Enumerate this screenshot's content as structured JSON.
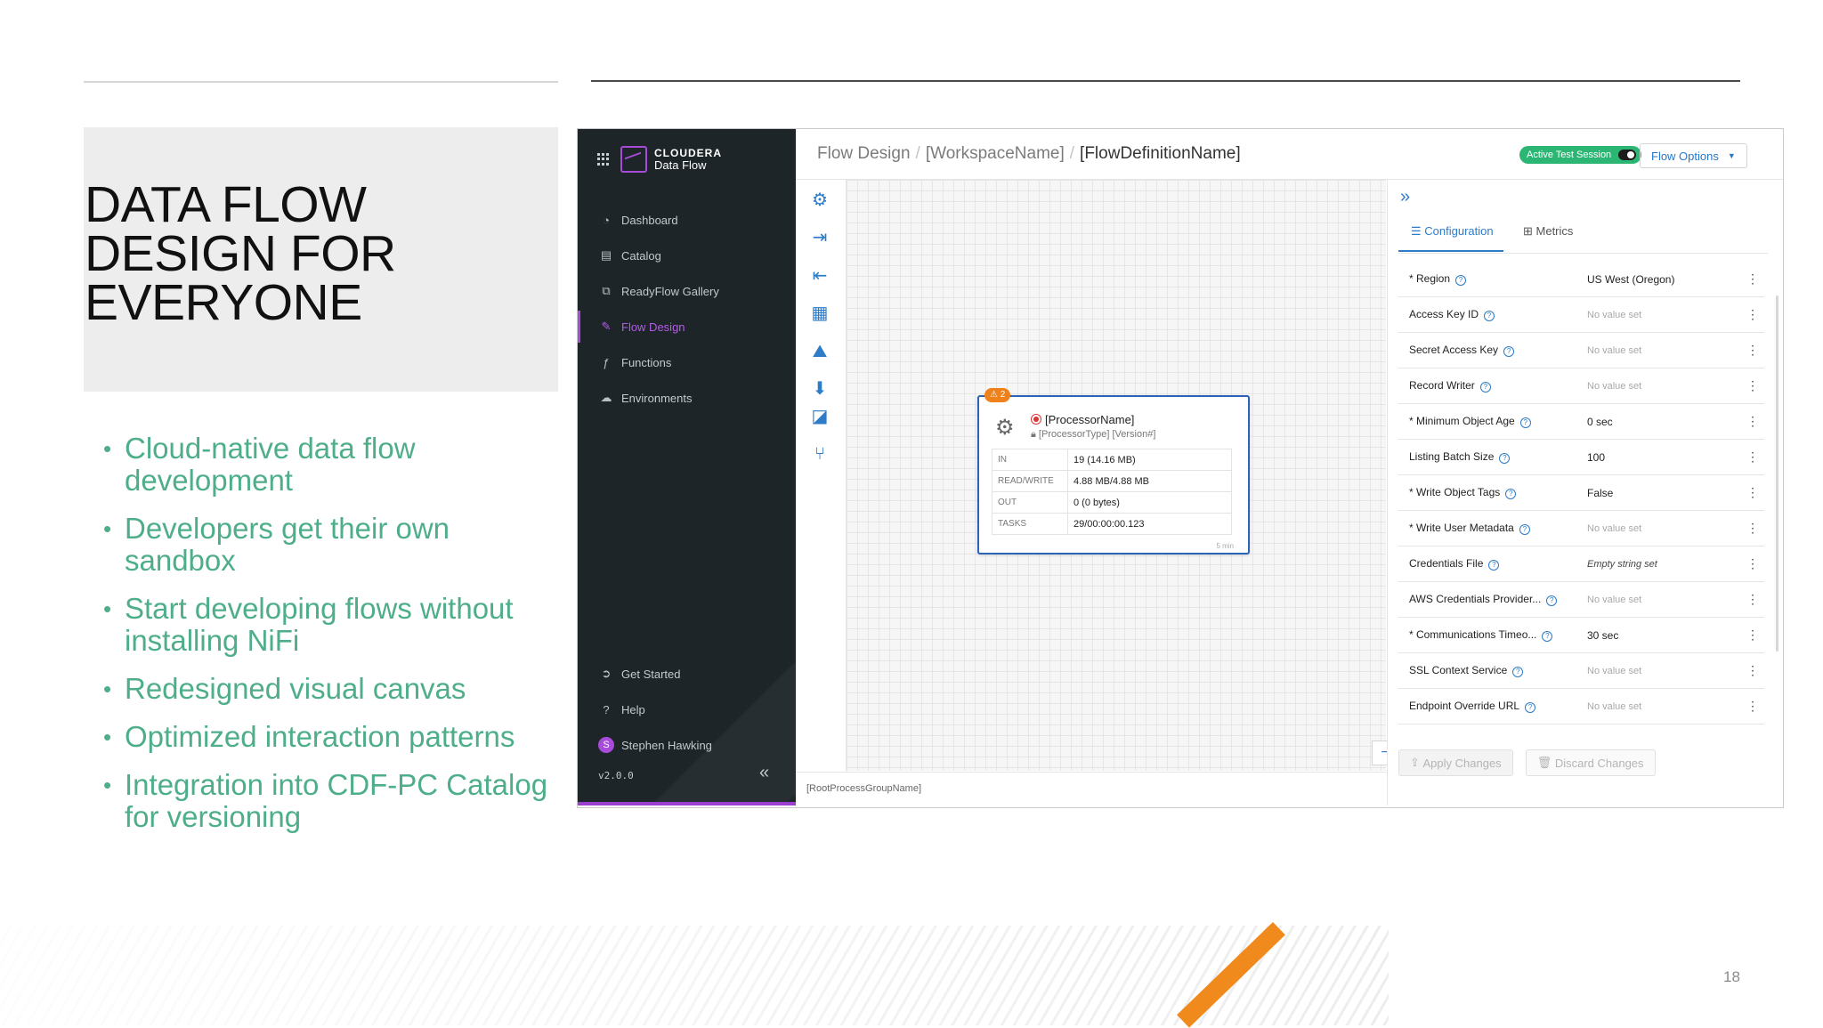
{
  "slide": {
    "title": "DATA FLOW\nDESIGN FOR\nEVERYONE",
    "bullets": [
      "Cloud-native data flow development",
      "Developers get their own sandbox",
      "Start developing flows without installing NiFi",
      "Redesigned visual canvas",
      "Optimized interaction patterns",
      "Integration into CDF-PC Catalog for versioning"
    ],
    "page_number": "18"
  },
  "app": {
    "brand_line1": "CLOUDERA",
    "brand_line2": "Data Flow",
    "nav": [
      {
        "label": "Dashboard",
        "icon": "gauge-icon"
      },
      {
        "label": "Catalog",
        "icon": "catalog-icon"
      },
      {
        "label": "ReadyFlow Gallery",
        "icon": "readyflow-icon"
      },
      {
        "label": "Flow Design",
        "icon": "edit-icon",
        "active": true
      },
      {
        "label": "Functions",
        "icon": "function-icon"
      },
      {
        "label": "Environments",
        "icon": "cloud-icon"
      }
    ],
    "footer_nav": [
      {
        "label": "Get Started",
        "icon": "arrow-circle-icon"
      },
      {
        "label": "Help",
        "icon": "help-icon"
      },
      {
        "label": "Stephen Hawking",
        "icon": "avatar",
        "initial": "S"
      }
    ],
    "version": "v2.0.0",
    "breadcrumbs": [
      "Flow Design",
      "[WorkspaceName]",
      "[FlowDefinitionName]"
    ],
    "session_label": "Active Test Session",
    "flow_options_label": "Flow Options",
    "canvas_footer": "[RootProcessGroupName]",
    "zoom": {
      "minus": "−",
      "plus": "+"
    },
    "processor": {
      "badge": "⚠ 2",
      "name": "[ProcessorName]",
      "type": "[ProcessorType] [Version#]",
      "stats": [
        {
          "key": "IN",
          "value": "19 (14.16 MB)"
        },
        {
          "key": "READ/WRITE",
          "value": "4.88 MB/4.88 MB"
        },
        {
          "key": "OUT",
          "value": "0 (0 bytes)"
        },
        {
          "key": "TASKS",
          "value": "29/00:00:00.123"
        }
      ],
      "interval": "5 min"
    },
    "panel": {
      "tabs": [
        "Configuration",
        "Metrics"
      ],
      "properties": [
        {
          "name": "* Region",
          "value": "US West (Oregon)",
          "style": "set"
        },
        {
          "name": "Access Key ID",
          "value": "No value set",
          "style": "empty"
        },
        {
          "name": "Secret Access Key",
          "value": "No value set",
          "style": "empty"
        },
        {
          "name": "Record Writer",
          "value": "No value set",
          "style": "empty"
        },
        {
          "name": "* Minimum Object Age",
          "value": "0 sec",
          "style": "set"
        },
        {
          "name": "Listing Batch Size",
          "value": "100",
          "style": "set"
        },
        {
          "name": "* Write Object Tags",
          "value": "False",
          "style": "set"
        },
        {
          "name": "* Write User Metadata",
          "value": "No value set",
          "style": "empty"
        },
        {
          "name": "Credentials File",
          "value": "Empty string set",
          "style": "italic"
        },
        {
          "name": "AWS Credentials Provider...",
          "value": "No value set",
          "style": "empty"
        },
        {
          "name": "* Communications Timeo...",
          "value": "30 sec",
          "style": "set"
        },
        {
          "name": "SSL Context Service",
          "value": "No value set",
          "style": "empty"
        },
        {
          "name": "Endpoint Override URL",
          "value": "No value set",
          "style": "empty"
        }
      ],
      "apply_label": "Apply Changes",
      "discard_label": "Discard Changes"
    }
  }
}
